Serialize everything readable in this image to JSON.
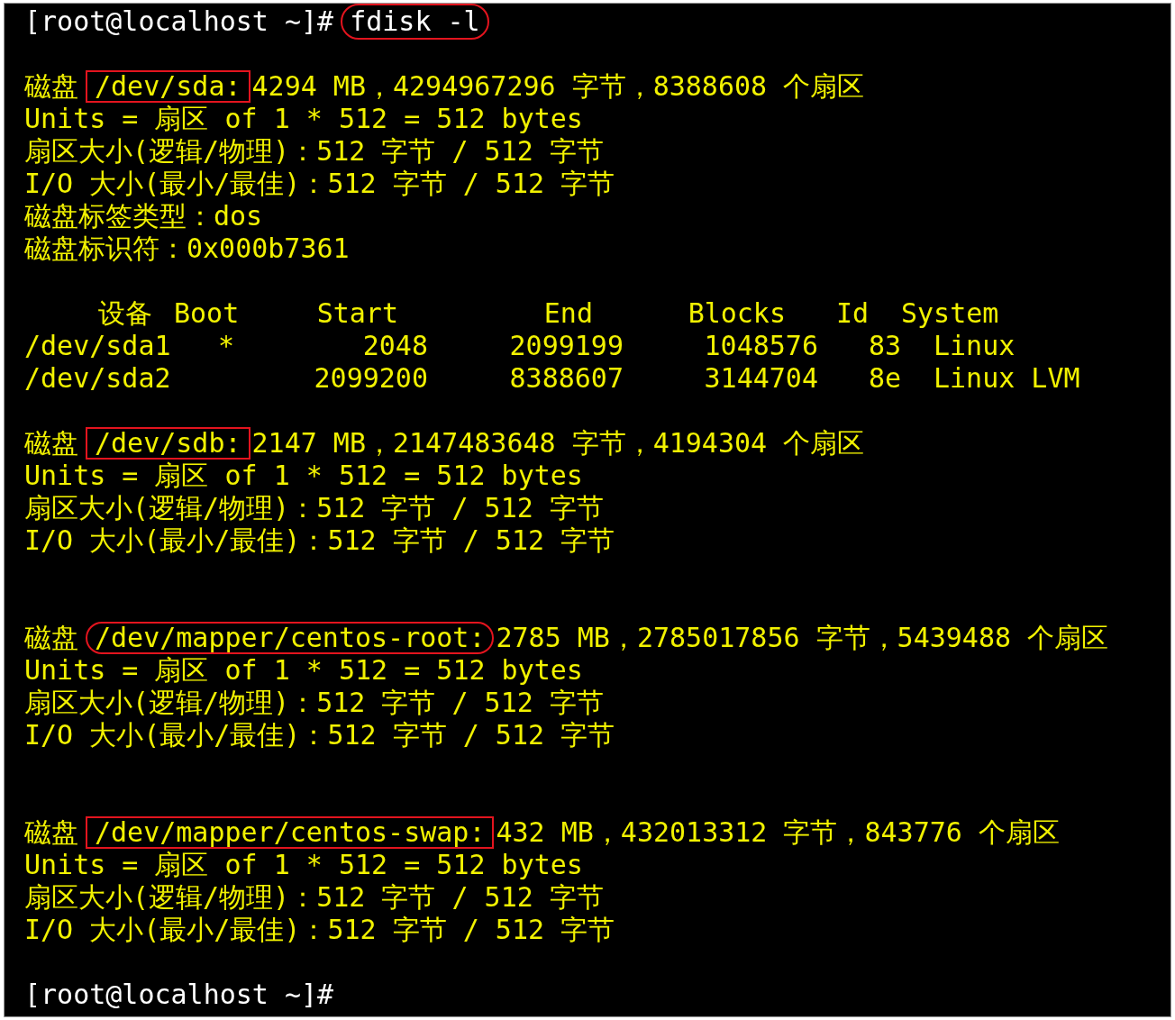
{
  "terminal": {
    "lines": [
      {
        "kind": "prompt",
        "prompt": "[root@localhost ~]#",
        "command": "fdisk -l",
        "boxed": false,
        "circled": true
      },
      {
        "kind": "blank"
      },
      {
        "kind": "disk",
        "label": "磁盘",
        "device": "/dev/sda:",
        "boxed": true,
        "circled": false,
        "info": "4294 MB，4294967296 字节，8388608 个扇区"
      },
      {
        "kind": "text",
        "text": "Units = 扇区 of 1 * 512 = 512 bytes"
      },
      {
        "kind": "text",
        "text": "扇区大小(逻辑/物理)：512 字节 / 512 字节"
      },
      {
        "kind": "text",
        "text": "I/O 大小(最小/最佳)：512 字节 / 512 字节"
      },
      {
        "kind": "text",
        "text": "磁盘标签类型：dos"
      },
      {
        "kind": "text",
        "text": "磁盘标识符：0x000b7361"
      },
      {
        "kind": "blank"
      },
      {
        "kind": "table",
        "columns": [
          "设备",
          "Boot",
          "Start",
          "End",
          "Blocks",
          "Id",
          "System"
        ],
        "rows": [
          {
            "device": "/dev/sda1",
            "boot": "*",
            "start": "2048",
            "end": "2099199",
            "blocks": "1048576",
            "id": "83",
            "system": "Linux"
          },
          {
            "device": "/dev/sda2",
            "start": "2099200",
            "end": "8388607",
            "blocks": "3144704",
            "id": "8e",
            "system": "Linux LVM"
          }
        ]
      },
      {
        "kind": "blank"
      },
      {
        "kind": "disk",
        "label": "磁盘",
        "device": "/dev/sdb:",
        "boxed": true,
        "circled": false,
        "info": "2147 MB，2147483648 字节，4194304 个扇区"
      },
      {
        "kind": "text",
        "text": "Units = 扇区 of 1 * 512 = 512 bytes"
      },
      {
        "kind": "text",
        "text": "扇区大小(逻辑/物理)：512 字节 / 512 字节"
      },
      {
        "kind": "text",
        "text": "I/O 大小(最小/最佳)：512 字节 / 512 字节"
      },
      {
        "kind": "blank"
      },
      {
        "kind": "blank"
      },
      {
        "kind": "disk",
        "label": "磁盘",
        "device": "/dev/mapper/centos-root:",
        "boxed": false,
        "circled": true,
        "info": "2785 MB，2785017856 字节，5439488 个扇区"
      },
      {
        "kind": "text",
        "text": "Units = 扇区 of 1 * 512 = 512 bytes"
      },
      {
        "kind": "text",
        "text": "扇区大小(逻辑/物理)：512 字节 / 512 字节"
      },
      {
        "kind": "text",
        "text": "I/O 大小(最小/最佳)：512 字节 / 512 字节"
      },
      {
        "kind": "blank"
      },
      {
        "kind": "blank"
      },
      {
        "kind": "disk",
        "label": "磁盘",
        "device": "/dev/mapper/centos-swap:",
        "boxed": true,
        "circled": false,
        "info": "432 MB，432013312 字节，843776 个扇区"
      },
      {
        "kind": "text",
        "text": "Units = 扇区 of 1 * 512 = 512 bytes"
      },
      {
        "kind": "text",
        "text": "扇区大小(逻辑/物理)：512 字节 / 512 字节"
      },
      {
        "kind": "text",
        "text": "I/O 大小(最小/最佳)：512 字节 / 512 字节"
      },
      {
        "kind": "blank"
      },
      {
        "kind": "prompt",
        "prompt": "[root@localhost ~]#"
      }
    ]
  }
}
